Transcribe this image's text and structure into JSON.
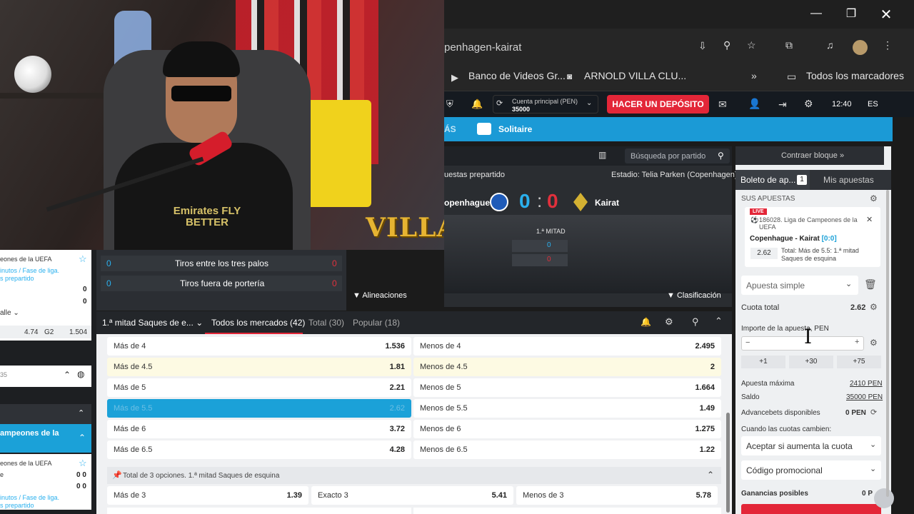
{
  "browser": {
    "url_fragment": "penhagen-kairat",
    "bookmarks": [
      "Banco de Videos Gr...",
      "ARNOLD VILLA CLU...",
      "Todos los marcadores"
    ]
  },
  "site": {
    "account_label": "Cuenta principal (PEN)",
    "account_balance": "35000",
    "deposit_label": "HACER UN DEPÓSITO",
    "time": "12:40",
    "lang": "ES",
    "nav_more": "ÁS",
    "nav_solitaire": "Solitaire"
  },
  "match": {
    "search_placeholder": "Búsqueda por partido",
    "prematch": "uestas prepartido",
    "stadium": "Estadio: Telia Parken (Copenhagen)",
    "home": "openhague",
    "away": "Kairat",
    "score_home": "0",
    "score_sep": ":",
    "score_away": "0",
    "half_label": "1.ª MITAD",
    "half_home": "0",
    "half_away": "0",
    "lineups": "Alineaciones",
    "classification": "Clasificación"
  },
  "webcam": {
    "overlay_text": "VILLA",
    "shirt_text": "Emirates FLY BETTER"
  },
  "stats": [
    {
      "label": "Tiros entre los tres palos",
      "home": "0",
      "away": "0"
    },
    {
      "label": "Tiros fuera de portería",
      "home": "0",
      "away": "0"
    }
  ],
  "left_col": {
    "card1_title": "eones de la UEFA",
    "card1_sub1": "inutos / Fase de liga.",
    "card1_sub2": "s prepartido",
    "card1_v1": "0",
    "card1_v2": "0",
    "detail": "alle",
    "odd1": "4.74",
    "odd_label": "G2",
    "odd2": "1.504",
    "row_num": "35",
    "blue_card_title1": "ampeones de la",
    "blue_card_title2": "",
    "card2_title": "eones de la UEFA",
    "card2_v": "0 0",
    "card2_v2": "0 0",
    "card2_sub1": "inutos / Fase de liga.",
    "card2_sub2": "s prepartido",
    "card2_e": "e"
  },
  "markets": {
    "dropdown": "1.ª mitad Saques de e...",
    "tabs": [
      "Todos los mercados (42)",
      "Total (30)",
      "Popular (18)"
    ],
    "rows": [
      {
        "left": "Más de 4",
        "left_odd": "1.536",
        "right": "Menos de 4",
        "right_odd": "2.495"
      },
      {
        "left": "Más de 4.5",
        "left_odd": "1.81",
        "right": "Menos de 4.5",
        "right_odd": "2"
      },
      {
        "left": "Más de 5",
        "left_odd": "2.21",
        "right": "Menos de 5",
        "right_odd": "1.664"
      },
      {
        "left": "Más de 5.5",
        "left_odd": "2.62",
        "right": "Menos de 5.5",
        "right_odd": "1.49"
      },
      {
        "left": "Más de 6",
        "left_odd": "3.72",
        "right": "Menos de 6",
        "right_odd": "1.275"
      },
      {
        "left": "Más de 6.5",
        "left_odd": "4.28",
        "right": "Menos de 6.5",
        "right_odd": "1.22"
      }
    ],
    "group2_title": "Total de 3 opciones. 1.ª mitad Saques de esquina",
    "group2_row": [
      {
        "label": "Más de 3",
        "odd": "1.39"
      },
      {
        "label": "Exacto 3",
        "odd": "5.41"
      },
      {
        "label": "Menos de 3",
        "odd": "5.78"
      }
    ]
  },
  "slip": {
    "collapse": "Contraer bloque",
    "tab_ticket": "Boleto de ap...",
    "tab_count": "1",
    "tab_mine": "Mis apuestas",
    "your_bets": "SUS APUESTAS",
    "live": "LIVE",
    "league": "186028. Liga de Campeones de la UEFA",
    "teams": "Copenhague - Kairat",
    "teams_score": "[0:0]",
    "odd": "2.62",
    "market": "Total: Más de 5.5: 1.ª mitad Saques de esquina",
    "bet_type": "Apuesta simple",
    "total_odds_label": "Cuota total",
    "total_odds": "2.62",
    "amount_label": "Importe de la apuesta, PEN",
    "quick": [
      "+1",
      "+30",
      "+75"
    ],
    "max_label": "Apuesta máxima",
    "max_value": "2410 PEN",
    "balance_label": "Saldo",
    "balance_value": "35000 PEN",
    "advance_label": "Advancebets disponibles",
    "advance_value": "0 PEN",
    "odds_change_label": "Cuando las cuotas cambien:",
    "odds_change_value": "Aceptar si aumenta la cuota",
    "promo": "Código promocional",
    "winnings_label": "Ganancias posibles",
    "winnings_value": "0 P"
  }
}
